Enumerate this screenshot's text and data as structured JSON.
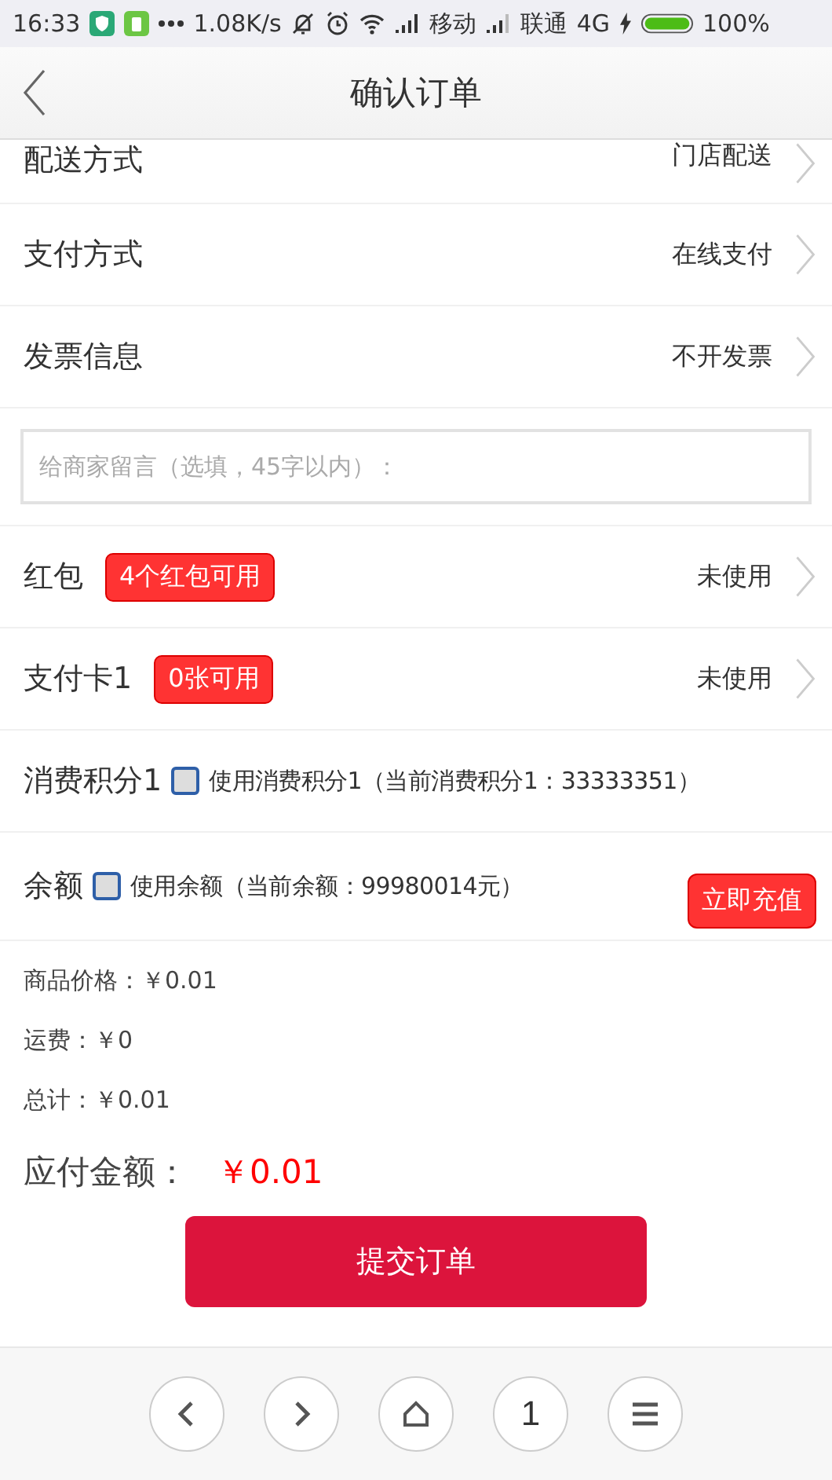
{
  "status_bar": {
    "time": "16:33",
    "speed": "1.08K/s",
    "carrier_1": "移动",
    "carrier_2": "联通",
    "network": "4G",
    "battery": "100%"
  },
  "header": {
    "title": "确认订单"
  },
  "rows": [
    {
      "kind": "select",
      "label": "配送方式",
      "value": "门店配送"
    },
    {
      "kind": "select",
      "label": "支付方式",
      "value": "在线支付"
    },
    {
      "kind": "select",
      "label": "发票信息",
      "value": "不开发票"
    },
    {
      "kind": "message",
      "placeholder": "给商家留言（选填，45字以内）："
    },
    {
      "kind": "coupon",
      "label": "红包",
      "badge": "4个红包可用",
      "value": "未使用"
    },
    {
      "kind": "coupon",
      "label": "支付卡1",
      "badge": "0张可用",
      "value": "未使用"
    },
    {
      "kind": "checkbox",
      "label": "消费积分1",
      "option": "使用消费积分1（当前消费积分1：33333351）",
      "checked": false
    },
    {
      "kind": "balance",
      "label": "余额",
      "option": "使用余额（当前余额：99980014元）",
      "checked": false,
      "button": "立即充值"
    }
  ],
  "summary": [
    "商品价格：￥0.01",
    "运费：￥0",
    "总计：￥0.01"
  ],
  "payable": {
    "label": "应付金额：",
    "amount": "￥0.01"
  },
  "submit": "提交订单",
  "bottom_nav": [
    {
      "kind": "back"
    },
    {
      "kind": "forward"
    },
    {
      "kind": "home"
    },
    {
      "kind": "tabs",
      "label": "1"
    },
    {
      "kind": "menu"
    }
  ]
}
